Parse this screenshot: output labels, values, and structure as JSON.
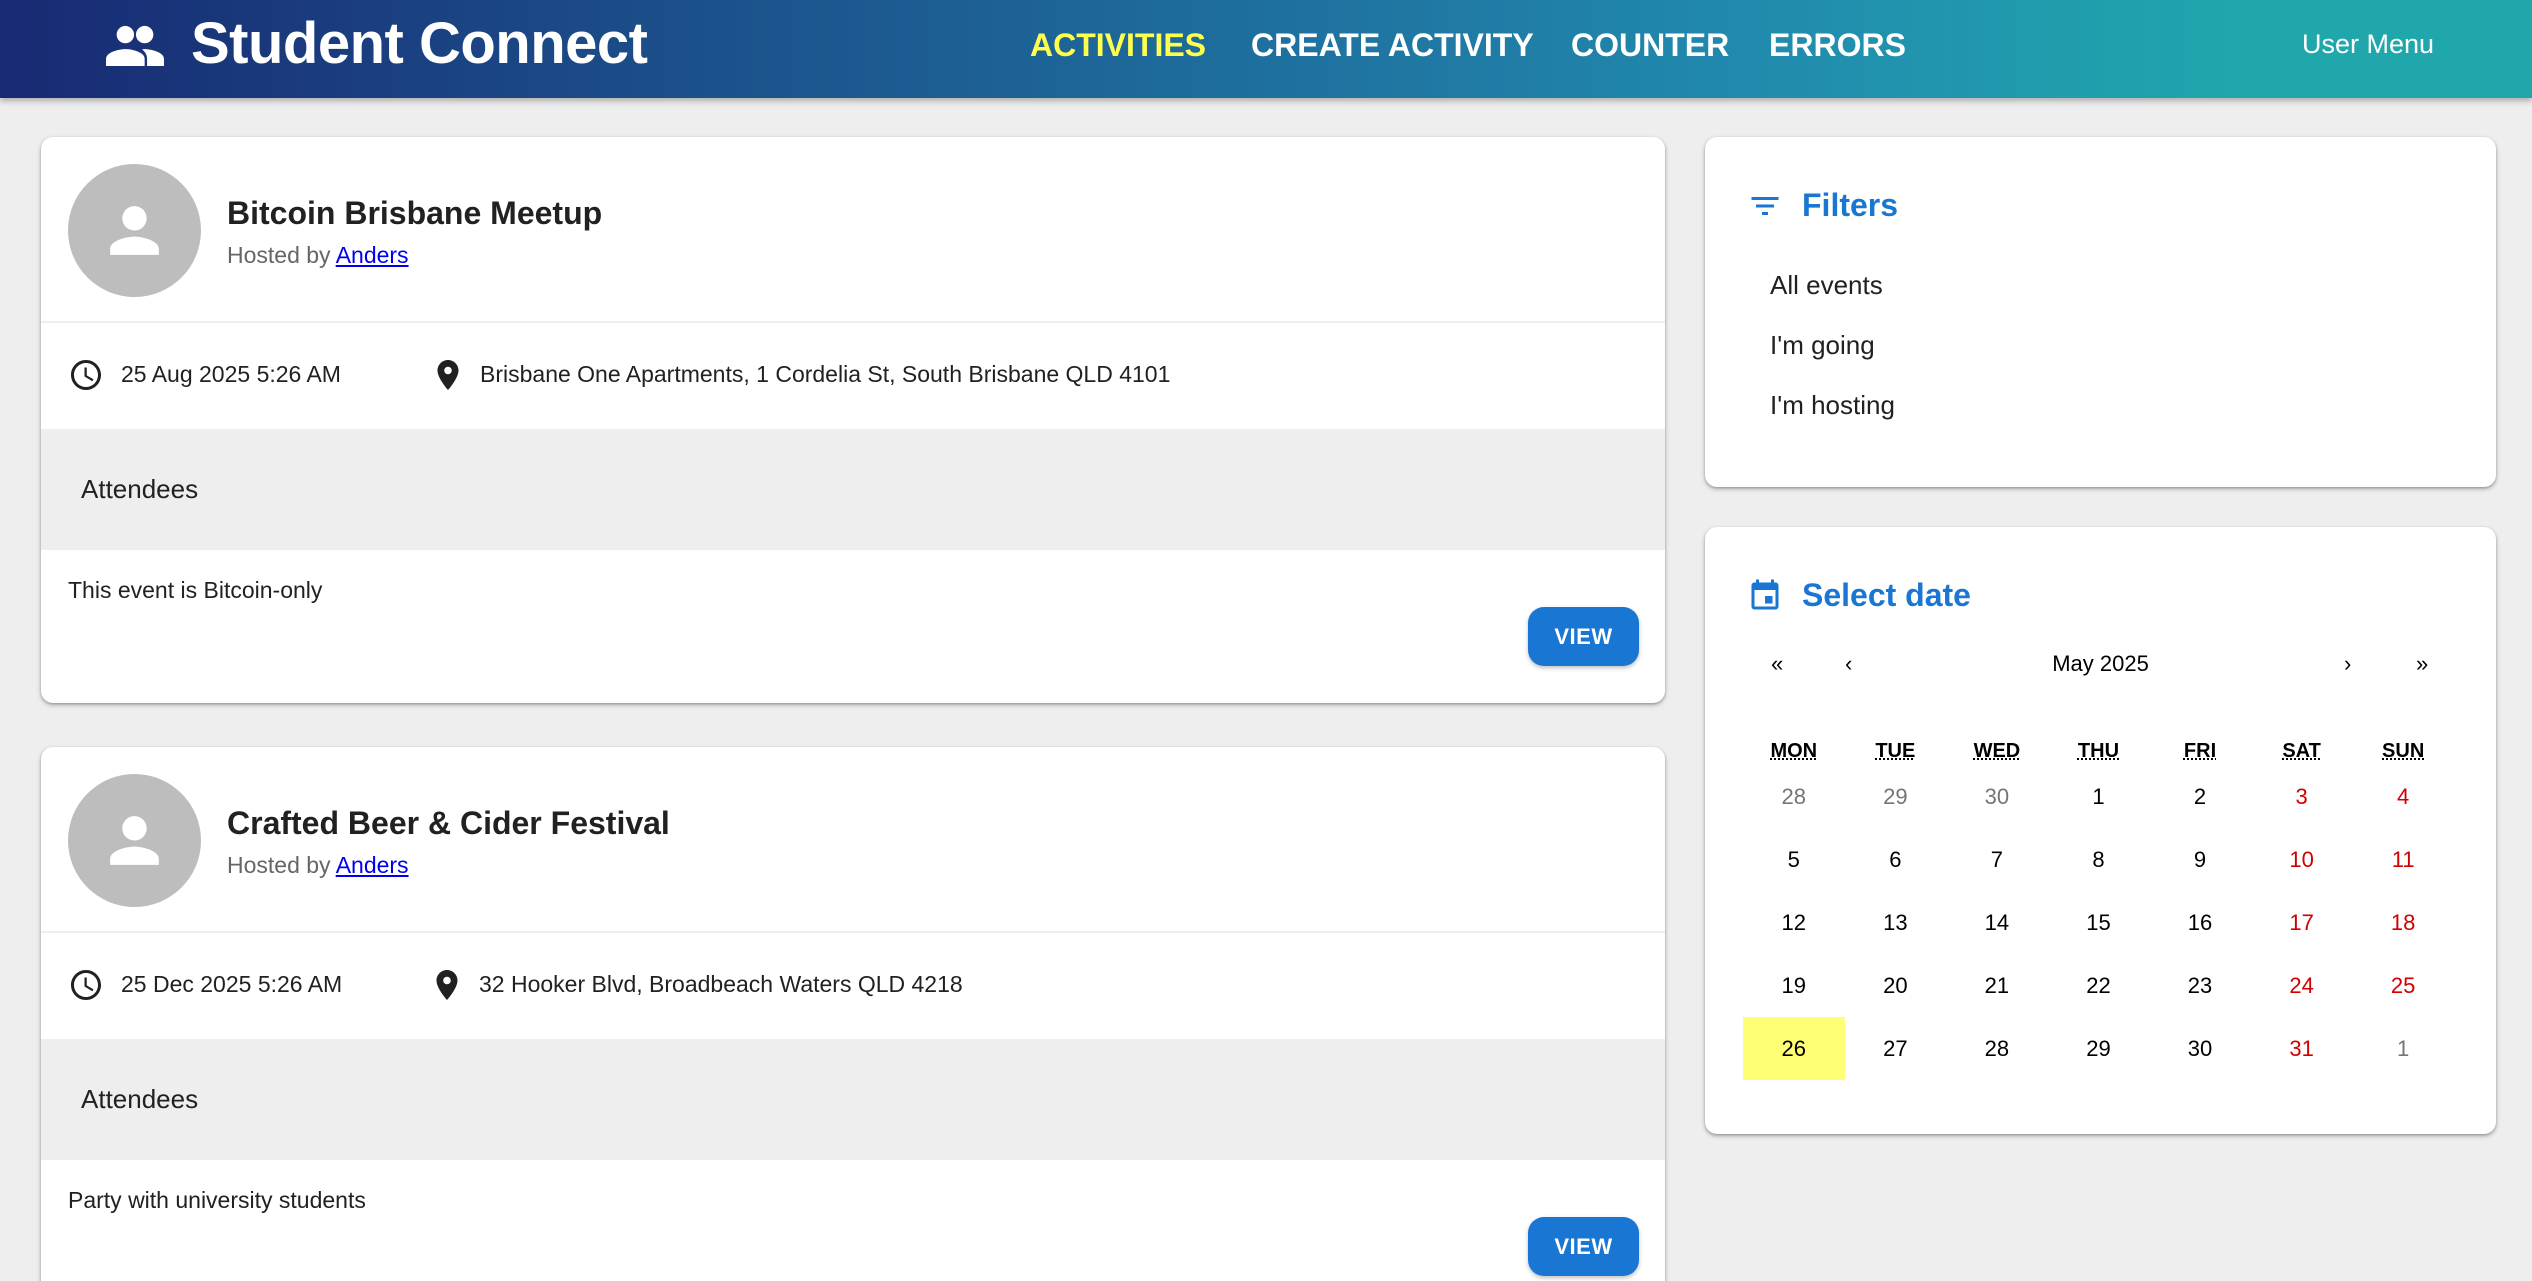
{
  "header": {
    "title": "Student Connect",
    "nav": [
      {
        "label": "ACTIVITIES",
        "active": true
      },
      {
        "label": "CREATE ACTIVITY",
        "active": false
      },
      {
        "label": "COUNTER",
        "active": false
      },
      {
        "label": "ERRORS",
        "active": false
      }
    ],
    "user_menu": "User Menu"
  },
  "activities": [
    {
      "title": "Bitcoin Brisbane Meetup",
      "hosted_prefix": "Hosted by",
      "host": "Anders",
      "date": "25 Aug 2025 5:26 AM",
      "venue": "Brisbane One Apartments, 1 Cordelia St, South Brisbane QLD 4101",
      "attendees_label": "Attendees",
      "description": "This event is Bitcoin-only",
      "view_label": "VIEW"
    },
    {
      "title": "Crafted Beer & Cider Festival",
      "hosted_prefix": "Hosted by",
      "host": "Anders",
      "date": "25 Dec 2025 5:26 AM",
      "venue": "32 Hooker Blvd, Broadbeach Waters QLD 4218",
      "attendees_label": "Attendees",
      "description": "Party with university students",
      "view_label": "VIEW"
    }
  ],
  "filters": {
    "title": "Filters",
    "items": [
      "All events",
      "I'm going",
      "I'm hosting"
    ]
  },
  "calendar": {
    "title": "Select date",
    "nav": {
      "prev_year": "«",
      "prev_month": "‹",
      "next_month": "›",
      "next_year": "»"
    },
    "month_label": "May 2025",
    "weekdays": [
      "MON",
      "TUE",
      "WED",
      "THU",
      "FRI",
      "SAT",
      "SUN"
    ],
    "weeks": [
      [
        "28",
        "29",
        "30",
        "1",
        "2",
        "3",
        "4"
      ],
      [
        "5",
        "6",
        "7",
        "8",
        "9",
        "10",
        "11"
      ],
      [
        "12",
        "13",
        "14",
        "15",
        "16",
        "17",
        "18"
      ],
      [
        "19",
        "20",
        "21",
        "22",
        "23",
        "24",
        "25"
      ],
      [
        "26",
        "27",
        "28",
        "29",
        "30",
        "31",
        "1"
      ]
    ],
    "selected": "26"
  },
  "colors": {
    "appbar_gradient_start": "#182a73",
    "appbar_gradient_end": "#20a7ac",
    "active_nav": "#ffff4d",
    "primary": "#1976d2",
    "weekend": "#d10000",
    "today_highlight": "#ffff76"
  },
  "icons": {
    "brand": "group-icon",
    "date": "clock-icon",
    "venue": "location-pin-icon",
    "filters": "filter-list-icon",
    "calendar": "event-icon",
    "avatar": "person-icon"
  }
}
